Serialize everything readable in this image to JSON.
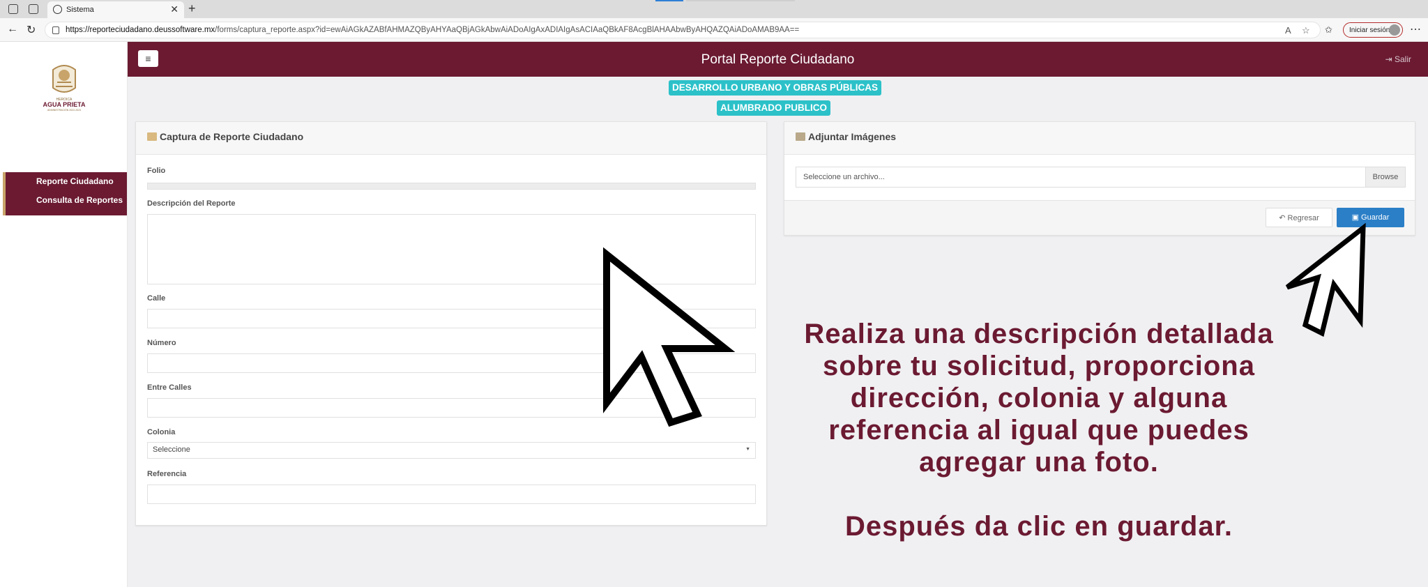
{
  "browser": {
    "tab_title": "Sistema",
    "url_host": "https://reporteciudadano.deussoftware.mx",
    "url_path": "/forms/captura_reporte.aspx?id=ewAiAGkAZABfAHMAZQByAHYAaQBjAGkAbwAiADoAIgAxADIAIgAsACIAaQBkAF8AcgBlAHAAbwByAHQAZQAiADoAMAB9AA==",
    "signin_label": "Iniciar sesión"
  },
  "sidebar": {
    "logo_text": "AGUA PRIETA",
    "items": [
      {
        "label": "Reporte Ciudadano"
      },
      {
        "label": "Consulta de Reportes"
      }
    ]
  },
  "header": {
    "menu_icon": "≡",
    "title": "Portal Reporte Ciudadano",
    "logout_label": "Salir"
  },
  "tags": {
    "department": "DESARROLLO URBANO Y OBRAS PÚBLICAS",
    "service": "ALUMBRADO PUBLICO"
  },
  "form": {
    "title": "Captura de Reporte Ciudadano",
    "folio_label": "Folio",
    "description_label": "Descripción del Reporte",
    "street_label": "Calle",
    "number_label": "Número",
    "between_label": "Entre Calles",
    "colony_label": "Colonia",
    "colony_value": "Seleccione",
    "reference_label": "Referencia"
  },
  "images": {
    "title": "Adjuntar Imágenes",
    "file_placeholder": "Seleccione un archivo...",
    "browse_label": "Browse",
    "back_label": "Regresar",
    "save_label": "Guardar"
  },
  "instructions": {
    "lines": [
      "Realiza una descripción detallada",
      "sobre tu solicitud, proporciona",
      "dirección, colonia y alguna",
      "referencia al igual que puedes",
      "agregar una foto."
    ],
    "final": "Después da clic en guardar."
  }
}
